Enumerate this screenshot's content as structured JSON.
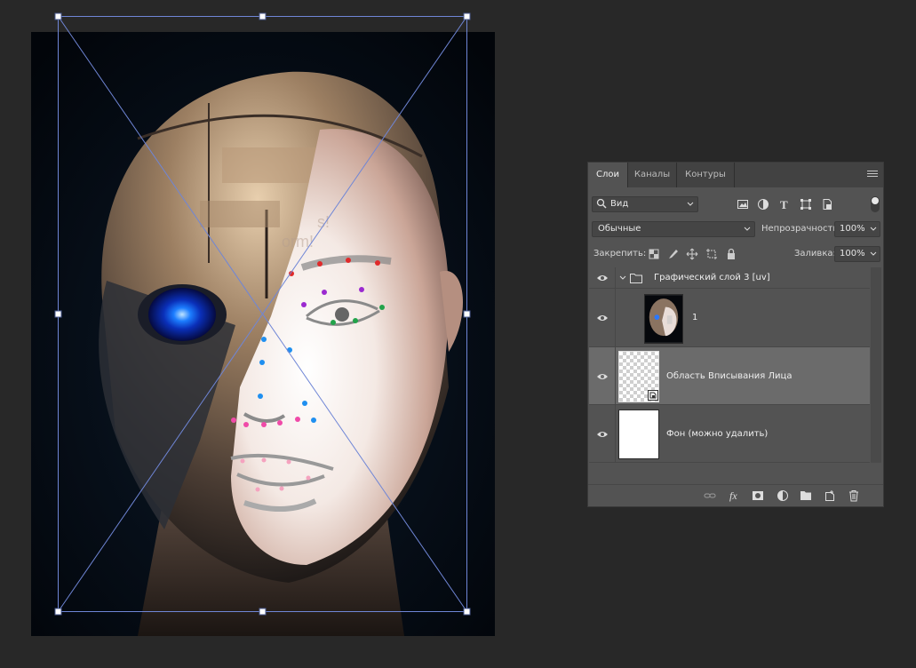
{
  "canvas": {
    "overlay_text": [
      "s!",
      "orm!"
    ]
  },
  "panel": {
    "tabs": [
      {
        "label": "Слои",
        "active": true
      },
      {
        "label": "Каналы",
        "active": false
      },
      {
        "label": "Контуры",
        "active": false
      }
    ],
    "filter": {
      "value": "Вид"
    },
    "blend_mode": {
      "value": "Обычные"
    },
    "opacity": {
      "label": "Непрозрачность:",
      "value": "100%"
    },
    "lock": {
      "label": "Закрепить:"
    },
    "fill": {
      "label": "Заливка:",
      "value": "100%"
    },
    "layers": [
      {
        "name": "Графический слой 3 [uv]",
        "type": "group",
        "visible": true
      },
      {
        "name": "1",
        "type": "image",
        "visible": true
      },
      {
        "name": "Область Вписывания Лица",
        "type": "smart-object",
        "visible": true,
        "selected": true
      },
      {
        "name": "Фон (можно удалить)",
        "type": "fill",
        "visible": true
      }
    ]
  },
  "colors": {
    "app_bg": "#282828",
    "panel_bg": "#535353",
    "selected_row": "#6b6b6b",
    "transform_line": "#6f86d6"
  }
}
